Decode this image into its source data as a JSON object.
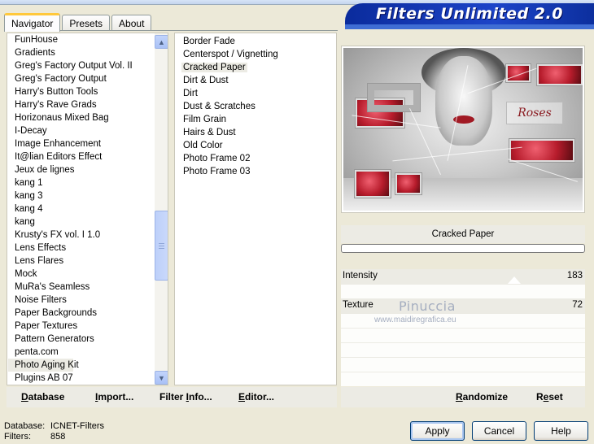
{
  "window": {
    "banner_title": "Filters Unlimited 2.0"
  },
  "tabs": [
    {
      "label": "Navigator",
      "active": true
    },
    {
      "label": "Presets",
      "active": false
    },
    {
      "label": "About",
      "active": false
    }
  ],
  "categories": {
    "items": [
      "FunHouse",
      "Gradients",
      "Greg's Factory Output Vol. II",
      "Greg's Factory Output",
      "Harry's Button Tools",
      "Harry's Rave Grads",
      "Horizonaus Mixed Bag",
      "I-Decay",
      "Image Enhancement",
      "It@lian Editors Effect",
      "Jeux de lignes",
      "kang 1",
      "kang 3",
      "kang 4",
      "kang",
      "Krusty's FX vol. I 1.0",
      "Lens Effects",
      "Lens Flares",
      "Mock",
      "MuRa's Seamless",
      "Noise Filters",
      "Paper Backgrounds",
      "Paper Textures",
      "Pattern Generators",
      "penta.com",
      "Photo Aging Kit",
      "Plugins AB 07"
    ],
    "selected": "Photo Aging Kit",
    "scroll_up_glyph": "▲",
    "scroll_down_glyph": "▼"
  },
  "filters": {
    "items": [
      "Border Fade",
      "Centerspot / Vignetting",
      "Cracked Paper",
      "Dirt & Dust",
      "Dirt",
      "Dust & Scratches",
      "Film Grain",
      "Hairs & Dust",
      "Old Color",
      "Photo Frame 02",
      "Photo Frame 03"
    ],
    "selected": "Cracked Paper"
  },
  "preview": {
    "logo_text": "Roses"
  },
  "settings": {
    "filter_name": "Cracked Paper",
    "intensity_label": "Intensity",
    "intensity_value": "183",
    "texture_label": "Texture",
    "texture_value": "72",
    "watermark_name": "Pinuccia",
    "watermark_url": "www.maidiregrafica.eu"
  },
  "toolbar_left": {
    "database": {
      "u": "D",
      "rest": "atabase"
    },
    "import": {
      "u": "I",
      "rest": "mport..."
    },
    "filter_info": {
      "pre": "Filter ",
      "u": "I",
      "rest": "nfo..."
    },
    "editor": {
      "u": "E",
      "rest": "ditor..."
    }
  },
  "toolbar_right": {
    "randomize": {
      "u": "R",
      "rest": "andomize"
    },
    "reset": {
      "pre": "R",
      "u": "e",
      "rest": "set"
    }
  },
  "status": {
    "database_label": "Database:",
    "database_value": "ICNET-Filters",
    "filters_label": "Filters:",
    "filters_value": "858"
  },
  "buttons": {
    "apply": "Apply",
    "cancel": "Cancel",
    "help": "Help"
  }
}
